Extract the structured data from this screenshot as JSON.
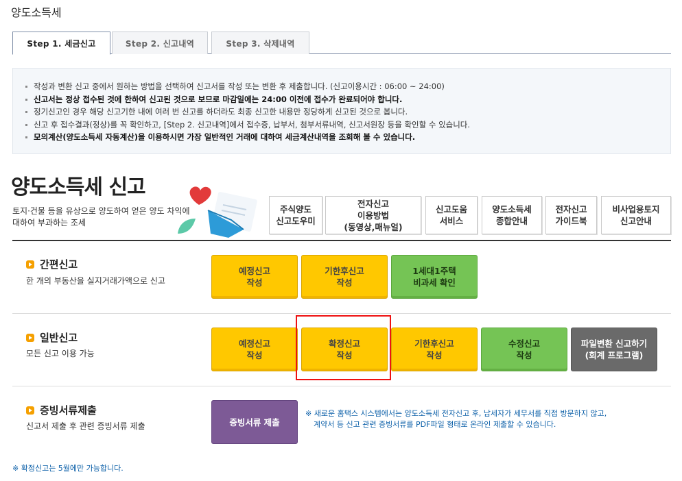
{
  "page_title": "양도소득세",
  "tabs": [
    {
      "label": "Step 1. 세금신고",
      "active": true
    },
    {
      "label": "Step 2. 신고내역",
      "active": false
    },
    {
      "label": "Step 3. 삭제내역",
      "active": false
    }
  ],
  "notice": [
    "작성과 변환 신고 중에서 원하는 방법을 선택하여 신고서를 작성 또는 변환 후 제출합니다. (신고이용시간 : 06:00 ~ 24:00)",
    "신고서는 정상 접수된 것에 한하여 신고된 것으로 보므로 마감일에는 24:00 이전에 접수가 완료되어야 합니다.",
    "정기신고인 경우 해당 신고기한 내에 여러 번 신고를 하더라도 최종 신고한 내용만 정당하게 신고된 것으로 봅니다.",
    "신고 후 접수결과(정상)를 꼭 확인하고, [Step 2. 신고내역]에서 접수증, 납부서, 첨부서류내역, 신고서원장 등을 확인할 수 있습니다.",
    "모의계산(양도소득세 자동계산)을 이용하시면 가장 일반적인 거래에 대하여 세금계산내역을 조회해 볼 수 있습니다."
  ],
  "hero": {
    "title": "양도소득세 신고",
    "desc_line1": "토지·건물 등을 유상으로 양도하여 얻은 양도 차익에",
    "desc_line2": "대하여 부과하는 조세"
  },
  "services": [
    {
      "l1": "주식양도",
      "l2": "신고도우미",
      "l3": ""
    },
    {
      "l1": "전자신고",
      "l2": "이용방법",
      "l3": "(동영상,매뉴얼)"
    },
    {
      "l1": "신고도움",
      "l2": "서비스",
      "l3": ""
    },
    {
      "l1": "양도소득세",
      "l2": "종합안내",
      "l3": ""
    },
    {
      "l1": "전자신고",
      "l2": "가이드북",
      "l3": ""
    },
    {
      "l1": "비사업용토지",
      "l2": "신고안내",
      "l3": ""
    }
  ],
  "sections": {
    "simple": {
      "title": "간편신고",
      "desc": "한 개의 부동산을 실지거래가액으로 신고",
      "buttons": [
        {
          "l1": "예정신고",
          "l2": "작성"
        },
        {
          "l1": "기한후신고",
          "l2": "작성"
        },
        {
          "l1": "1세대1주택",
          "l2": "비과세 확인"
        }
      ]
    },
    "general": {
      "title": "일반신고",
      "desc": "모든 신고 이용 가능",
      "buttons": [
        {
          "l1": "예정신고",
          "l2": "작성"
        },
        {
          "l1": "확정신고",
          "l2": "작성"
        },
        {
          "l1": "기한후신고",
          "l2": "작성"
        },
        {
          "l1": "수정신고",
          "l2": "작성"
        },
        {
          "l1": "파일변환 신고하기",
          "l2": "(회계 프로그램)"
        }
      ]
    },
    "evidence": {
      "title": "증빙서류제출",
      "desc": "신고서 제출 후 관련 증빙서류 제출",
      "button": "증빙서류 제출",
      "note_line1": "※ 새로운 홈택스 시스템에서는 양도소득세 전자신고 후, 납세자가 세무서를 직접 방문하지 않고,",
      "note_line2": "계약서 등 신고 관련 증빙서류를 PDF파일 형태로 온라인 제출할 수 있습니다."
    }
  },
  "footer_note": "※ 확정신고는 5월에만 가능합니다.",
  "icons": [
    "heart-icon",
    "envelope-icon",
    "leaf-icon",
    "section-bullet-icon"
  ],
  "colors": {
    "yellow": "#ffc800",
    "green": "#75c455",
    "gray": "#6a6a6a",
    "purple": "#7d5a96",
    "highlight": "#e11111",
    "note": "#0b5fa8"
  }
}
